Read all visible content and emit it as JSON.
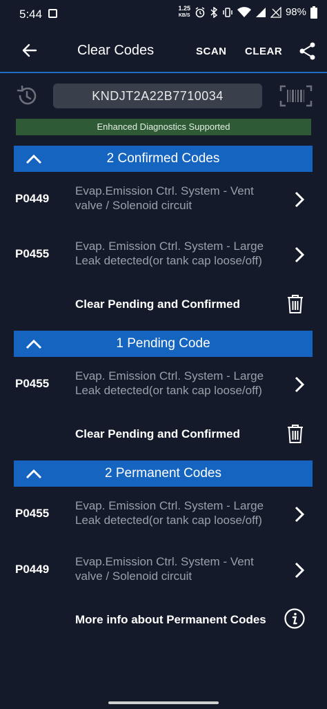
{
  "status_bar": {
    "time": "5:44",
    "net_speed_value": "1.25",
    "net_speed_unit": "KB/S",
    "battery": "98%"
  },
  "app_bar": {
    "title": "Clear Codes",
    "scan_label": "SCAN",
    "clear_label": "CLEAR"
  },
  "vin": "KNDJT2A22B7710034",
  "enhanced_banner": "Enhanced Diagnostics Supported",
  "sections": [
    {
      "title": "2 Confirmed Codes",
      "codes": [
        {
          "code": "P0449",
          "description": "Evap.Emission Ctrl. System - Vent valve / Solenoid circuit"
        },
        {
          "code": "P0455",
          "description": "Evap. Emission Ctrl. System - Large Leak detected(or tank cap loose/off)"
        }
      ],
      "action_label": "Clear Pending and Confirmed"
    },
    {
      "title": "1 Pending Code",
      "codes": [
        {
          "code": "P0455",
          "description": "Evap. Emission Ctrl. System - Large Leak detected(or tank cap loose/off)"
        }
      ],
      "action_label": "Clear Pending and Confirmed"
    },
    {
      "title": "2 Permanent Codes",
      "codes": [
        {
          "code": "P0455",
          "description": "Evap. Emission Ctrl. System - Large Leak detected(or tank cap loose/off)"
        },
        {
          "code": "P0449",
          "description": "Evap.Emission Ctrl. System - Vent valve / Solenoid circuit"
        }
      ],
      "action_label": "More info about Permanent Codes"
    }
  ],
  "colors": {
    "background": "#141a29",
    "accent_blue": "#1565c0",
    "banner_green": "#2e5b36",
    "vin_box": "#3a404b"
  }
}
